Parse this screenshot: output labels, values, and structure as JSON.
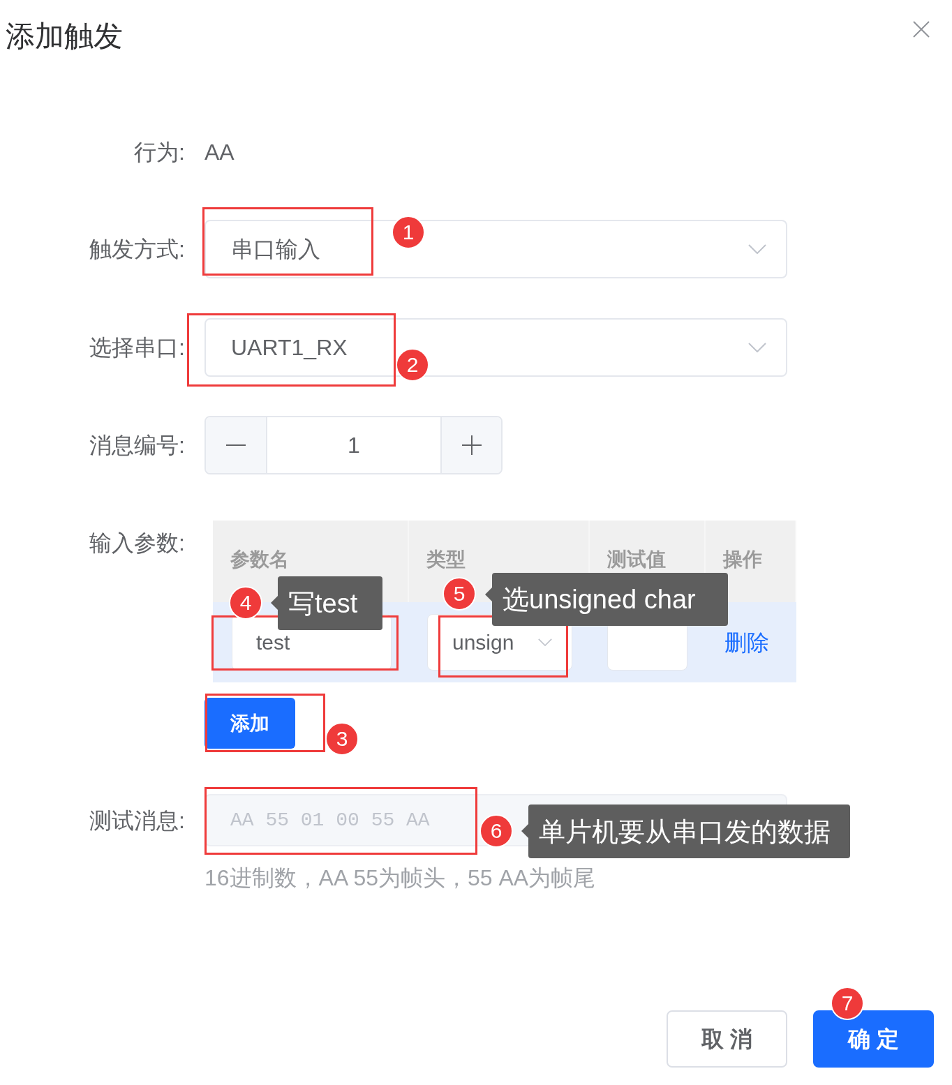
{
  "dialog": {
    "title": "添加触发"
  },
  "behavior": {
    "label": "行为:",
    "value": "AA"
  },
  "trigger_mode": {
    "label": "触发方式:",
    "value": "串口输入",
    "annotation": {
      "number": "1"
    }
  },
  "serial_port": {
    "label": "选择串口:",
    "value": "UART1_RX",
    "annotation": {
      "number": "2"
    }
  },
  "message_number": {
    "label": "消息编号:",
    "value": "1"
  },
  "input_params": {
    "label": "输入参数:",
    "table": {
      "columns": [
        "参数名",
        "类型",
        "测试值",
        "操作"
      ],
      "rows": [
        {
          "highlighted": true,
          "name": {
            "value": "test",
            "annotation": {
              "number": "4",
              "note": "写test"
            }
          },
          "type": {
            "value": "unsign",
            "annotation": {
              "number": "5",
              "note": "选unsigned char"
            }
          },
          "action": "删除"
        }
      ]
    },
    "add_button": {
      "label": "添加",
      "annotation": {
        "number": "3"
      }
    }
  },
  "test_message": {
    "label": "测试消息:",
    "placeholder": "AA 55 01 00 55 AA",
    "annotation": {
      "number": "6",
      "note": "单片机要从串口发的数据"
    },
    "hint": "16进制数，AA 55为帧头，55 AA为帧尾"
  },
  "footer": {
    "buttons": [
      {
        "label": "取 消",
        "kind": "default"
      },
      {
        "label": "确 定",
        "kind": "primary",
        "annotation": {
          "number": "7"
        }
      }
    ]
  }
}
